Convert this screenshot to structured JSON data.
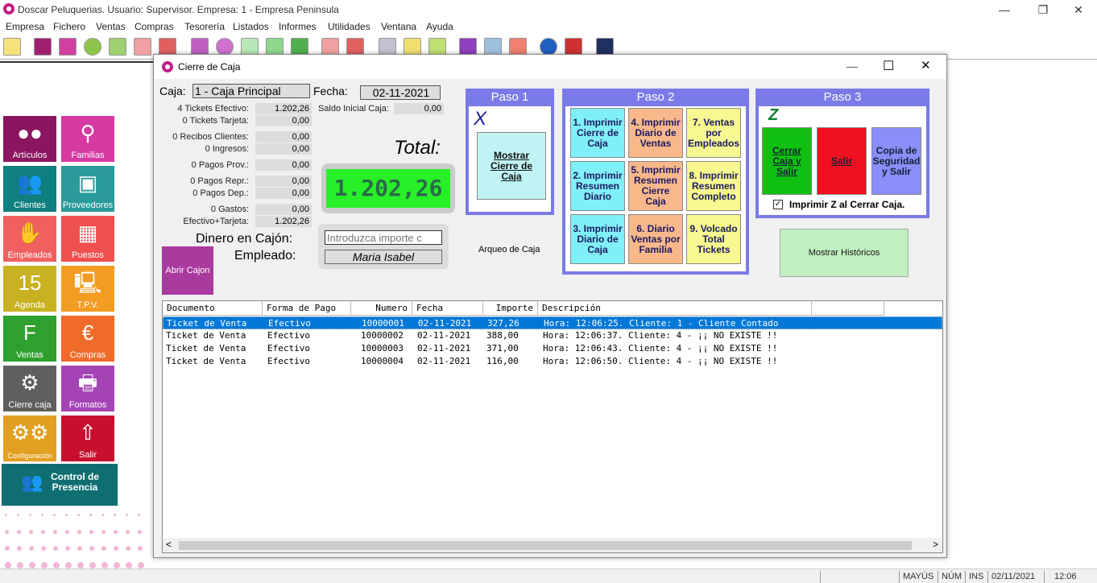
{
  "window": {
    "title": "Doscar Peluquerias. Usuario: Supervisor. Empresa: 1 - Empresa Peninsula",
    "minimize": "—",
    "restore": "❐",
    "close": "✕"
  },
  "menu": [
    "Empresa",
    "Fichero",
    "Ventas",
    "Compras",
    "Tesorería",
    "Listados",
    "Informes",
    "Utilidades",
    "Ventana",
    "Ayuda"
  ],
  "sidebar": {
    "tiles": [
      {
        "label": "Artículos",
        "color": "#8a1560",
        "glyph": "●●"
      },
      {
        "label": "Familias",
        "color": "#d63aa2",
        "glyph": "⚲"
      },
      {
        "label": "Clientes",
        "color": "#0f7f7f",
        "glyph": "👥"
      },
      {
        "label": "Proveedores",
        "color": "#2a9a9a",
        "glyph": "▣"
      },
      {
        "label": "Empleados",
        "color": "#f06060",
        "glyph": "✋"
      },
      {
        "label": "Puestos",
        "color": "#f05050",
        "glyph": "▦"
      },
      {
        "label": "Agenda",
        "color": "#c9b221",
        "glyph": "15"
      },
      {
        "label": "T.P.V.",
        "color": "#f39c22",
        "glyph": "🖳"
      },
      {
        "label": "Ventas",
        "color": "#2ea02e",
        "glyph": "F"
      },
      {
        "label": "Compras",
        "color": "#f06a2a",
        "glyph": "€"
      },
      {
        "label": "Cierre caja",
        "color": "#5f5f5f",
        "glyph": "⚙"
      },
      {
        "label": "Formatos",
        "color": "#a545b5",
        "glyph": "🖶"
      },
      {
        "label": "Configuración",
        "color": "#e2a020",
        "glyph": "⚙⚙"
      },
      {
        "label": "Salir",
        "color": "#c8102e",
        "glyph": "⇧"
      }
    ],
    "presence": {
      "line1": "Control de",
      "line2": "Presencia"
    }
  },
  "dialog": {
    "title": "Cierre de Caja",
    "caja_label": "Caja:",
    "caja_value": "1 - Caja Principal",
    "fecha_label": "Fecha:",
    "fecha_value": "02-11-2021",
    "saldo_label": "Saldo Inicial Caja:",
    "saldo_value": "0,00",
    "summary": [
      {
        "label": "4 Tickets Efectivo:",
        "value": "1.202,26"
      },
      {
        "label": "0 Tickets Tarjeta:",
        "value": "0,00"
      },
      {
        "label": "0 Recibos Clientes:",
        "value": "0,00"
      },
      {
        "label": "0 Ingresos:",
        "value": "0,00"
      },
      {
        "label": "0 Pagos Prov.:",
        "value": "0,00"
      },
      {
        "label": "0 Pagos Repr.:",
        "value": "0,00"
      },
      {
        "label": "0 Pagos Dep.:",
        "value": "0,00"
      },
      {
        "label": "0 Gastos:",
        "value": "0,00"
      },
      {
        "label": "Efectivo+Tarjeta:",
        "value": "1.202,26"
      }
    ],
    "total_label": "Total:",
    "total_value": "1.202,26",
    "dinero_label": "Dinero en Cajón:",
    "dinero_placeholder": "Introduzca importe c",
    "empleado_label": "Empleado:",
    "empleado_value": "Maria Isabel",
    "abrir_cajon": "Abrir Cajon",
    "arqueo": "Arqueo de Caja",
    "paso1": {
      "title": "Paso 1",
      "mark": "X",
      "button": "Mostrar Cierre de Caja"
    },
    "paso2": {
      "title": "Paso 2",
      "buttons": [
        {
          "label": "1. Imprimir Cierre de Caja",
          "color": "#80f0f8"
        },
        {
          "label": "4. Imprimir Diario de Ventas",
          "color": "#f8b88a"
        },
        {
          "label": "7. Ventas por Empleados",
          "color": "#f8f890"
        },
        {
          "label": "2. Imprimir Resumen Diario",
          "color": "#80f0f8"
        },
        {
          "label": "5. Imprimir Resumen Cierre Caja",
          "color": "#f8b88a"
        },
        {
          "label": "8. Imprimir Resumen Completo",
          "color": "#f8f890"
        },
        {
          "label": "3. Imprimir Diario de Caja",
          "color": "#80f0f8"
        },
        {
          "label": "6. Diario Ventas por Familia",
          "color": "#f8b88a"
        },
        {
          "label": "9. Volcado Total Tickets",
          "color": "#f8f890"
        }
      ]
    },
    "paso3": {
      "title": "Paso 3",
      "mark": "Z",
      "cerrar": "Cerrar Caja y Salir",
      "salir": "Salir",
      "copia": "Copia de Seguridad y Salir",
      "checkbox_label": "Imprimir Z al Cerrar Caja.",
      "checkbox_mark": "✓"
    },
    "historicos": "Mostrar Históricos",
    "grid": {
      "columns": [
        "Documento",
        "Forma de Pago",
        "Numero",
        "Fecha",
        "Importe",
        "Descripción"
      ],
      "rows": [
        [
          "Ticket de Venta",
          "Efectivo",
          "10000001",
          "02-11-2021",
          "327,26",
          "Hora: 12:06:25. Cliente: 1 - Cliente Contado"
        ],
        [
          "Ticket de Venta",
          "Efectivo",
          "10000002",
          "02-11-2021",
          "388,00",
          "Hora: 12:06:37. Cliente: 4 -  ¡¡ NO EXISTE !!"
        ],
        [
          "Ticket de Venta",
          "Efectivo",
          "10000003",
          "02-11-2021",
          "371,00",
          "Hora: 12:06:43. Cliente: 4 -  ¡¡ NO EXISTE !!"
        ],
        [
          "Ticket de Venta",
          "Efectivo",
          "10000004",
          "02-11-2021",
          "116,00",
          "Hora: 12:06:50. Cliente: 4 -  ¡¡ NO EXISTE !!"
        ]
      ],
      "scroll_left": "<",
      "scroll_right": ">"
    }
  },
  "status": {
    "mayus": "MAYÚS",
    "num": "NÚM",
    "ins": "INS",
    "date": "02/11/2021",
    "time": "12:06"
  }
}
